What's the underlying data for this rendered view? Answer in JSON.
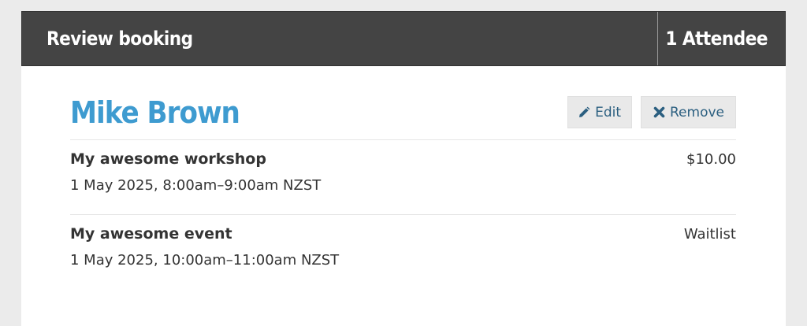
{
  "header": {
    "title": "Review booking",
    "count_label": "1 Attendee"
  },
  "attendee": {
    "name": "Mike Brown",
    "edit_label": "Edit",
    "remove_label": "Remove",
    "edit_icon": "pencil-icon",
    "remove_icon": "close-icon"
  },
  "sessions": [
    {
      "name": "My awesome workshop",
      "time": "1 May 2025, 8:00am–9:00am NZST",
      "price": "$10.00"
    },
    {
      "name": "My awesome event",
      "time": "1 May 2025, 10:00am–11:00am NZST",
      "price": "Waitlist"
    }
  ],
  "colors": {
    "header_bg": "#444444",
    "name_blue": "#3e9bd0",
    "button_text": "#2b5f80",
    "page_bg": "#ebebeb"
  }
}
